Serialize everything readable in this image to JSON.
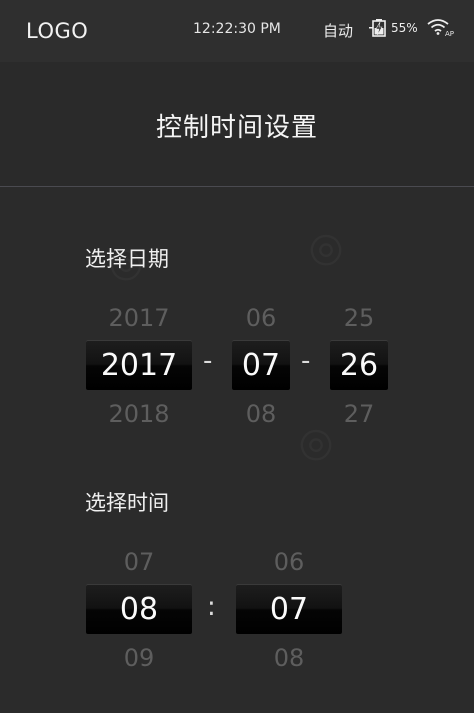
{
  "status": {
    "logo": "LOGO",
    "time": "12:22:30 PM",
    "mode": "自动",
    "battery": "55%",
    "wifi_badge": "AP"
  },
  "header": {
    "title": "控制时间设置"
  },
  "date": {
    "label": "选择日期",
    "separator": "-",
    "year": {
      "prev": "2017",
      "current": "2017",
      "next": "2018"
    },
    "month": {
      "prev": "06",
      "current": "07",
      "next": "08"
    },
    "day": {
      "prev": "25",
      "current": "26",
      "next": "27"
    }
  },
  "time": {
    "label": "选择时间",
    "separator": ":",
    "hour": {
      "prev": "07",
      "current": "08",
      "next": "09"
    },
    "minute": {
      "prev": "06",
      "current": "07",
      "next": "08"
    }
  },
  "colors": {
    "background": "#2b2b2b",
    "wheel": "#0a0a0a",
    "ghost_text": "#5e5e5e"
  }
}
